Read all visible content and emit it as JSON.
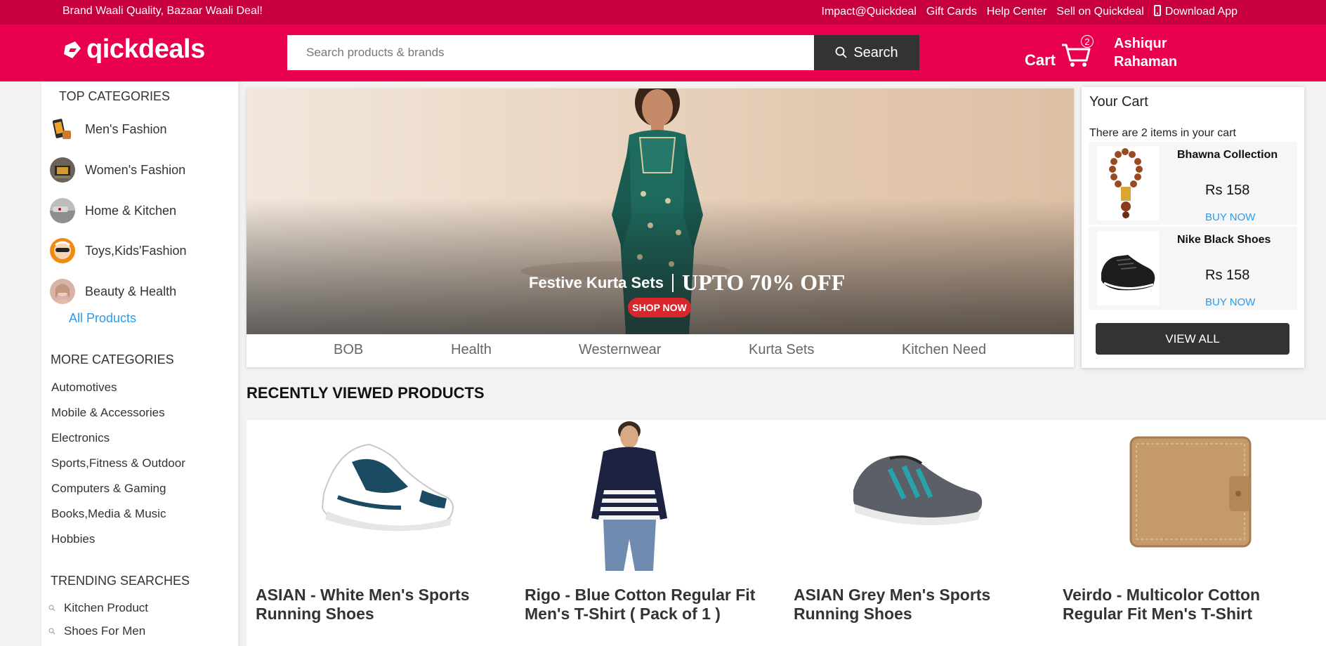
{
  "topbar": {
    "tagline": "Brand Waali Quality, Bazaar Waali Deal!",
    "links": [
      "Impact@Quickdeal",
      "Gift Cards",
      "Help Center",
      "Sell on Quickdeal",
      "Download App"
    ]
  },
  "header": {
    "logo_text": "qickdeals",
    "search_placeholder": "Search products & brands",
    "search_button": "Search",
    "cart_label": "Cart",
    "cart_count": "2",
    "user_first": "Ashiqur",
    "user_last": "Rahaman"
  },
  "sidebar": {
    "top_categories_title": "TOP CATEGORIES",
    "top_categories": [
      "Men's Fashion",
      "Women's Fashion",
      "Home & Kitchen",
      "Toys,Kids'Fashion",
      "Beauty & Health"
    ],
    "all_products": "All Products",
    "more_categories_title": "MORE CATEGORIES",
    "more_categories": [
      "Automotives",
      "Mobile & Accessories",
      "Electronics",
      "Sports,Fitness & Outdoor",
      "Computers & Gaming",
      "Books,Media & Music",
      "Hobbies"
    ],
    "trending_title": "TRENDING SEARCHES",
    "trending": [
      "Kitchen Product",
      "Shoes For Men"
    ]
  },
  "banner": {
    "caption_left": "Festive Kurta Sets",
    "caption_right": "UPTO 70% OFF",
    "cta": "SHOP NOW",
    "tabs": [
      "BOB",
      "Health",
      "Westernwear",
      "Kurta Sets",
      "Kitchen Need"
    ]
  },
  "your_cart": {
    "title": "Your Cart",
    "subtitle": "There are 2 items in your cart",
    "items": [
      {
        "name": "Bhawna Collection",
        "price": "Rs 158",
        "action": "BUY NOW"
      },
      {
        "name": "Nike Black Shoes",
        "price": "Rs 158",
        "action": "BUY NOW"
      }
    ],
    "view_all": "VIEW ALL"
  },
  "recent": {
    "title": "RECENTLY VIEWED PRODUCTS",
    "products": [
      {
        "title": "ASIAN - White Men's Sports Running Shoes"
      },
      {
        "title": "Rigo - Blue Cotton Regular Fit Men's T-Shirt ( Pack of 1 )"
      },
      {
        "title": "ASIAN Grey Men's Sports Running Shoes"
      },
      {
        "title": "Veirdo - Multicolor Cotton Regular Fit Men's T-Shirt"
      }
    ]
  },
  "colors": {
    "topstrip": "#c8003f",
    "header": "#e8004f",
    "button_dark": "#333333",
    "link_blue": "#2a9be8"
  }
}
